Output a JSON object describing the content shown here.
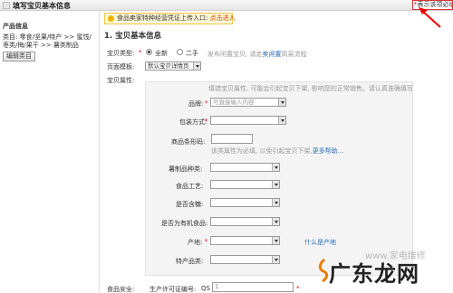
{
  "titlebar": {
    "title": "填写宝贝基本信息",
    "required_note_star": "*",
    "required_note": "表示该项必填"
  },
  "sidebar": {
    "heading": "产品信息",
    "category": "类目: 零食/坚果/特产 >> 蜜饯/枣类/梅/果干 >> 薯类制品",
    "edit_button": "编辑类目"
  },
  "notice": {
    "text": "食品卖家特种经营凭证上传入口: ",
    "link": "点击进入"
  },
  "section": {
    "title": "1. 宝贝基本信息"
  },
  "item_type": {
    "label": "宝贝类型:",
    "required": "*",
    "options": [
      "全新",
      "二手"
    ],
    "selected": "全新",
    "hint_prefix": "发布闲置宝贝, 请走",
    "hint_link": "卖闲置",
    "hint_suffix": "简易流程"
  },
  "template": {
    "label": "页面模板:",
    "value": "默认宝贝详情页"
  },
  "attributes": {
    "label": "宝贝属性:",
    "intro": "填错宝贝属性, 可能会引起宝贝下架, 影响您的正常销售。请认真准确填写",
    "brand": {
      "label": "品牌:",
      "required": "*",
      "placeholder": "可直接输入内容"
    },
    "packaging": {
      "label": "包装方式:",
      "required": "*",
      "value": ""
    },
    "barcode": {
      "label": "商品条形码:",
      "value": "",
      "hint": "该类属性为必填, 以免引起宝贝下架,",
      "help_link": "更多帮助..."
    },
    "potato_type": {
      "label": "薯制品种类:",
      "value": ""
    },
    "craft": {
      "label": "食品工艺:",
      "value": ""
    },
    "sugar": {
      "label": "是否含糖:",
      "value": ""
    },
    "organic": {
      "label": "是否为有机食品:",
      "value": ""
    },
    "origin": {
      "label": "产地:",
      "required": "*",
      "value": "",
      "help_link": "什么是产地"
    },
    "specialty": {
      "label": "特产品类:",
      "value": ""
    }
  },
  "food_safety": {
    "label": "食品安全:",
    "license_label": "生产许可证编号:",
    "license_prefix": "QS",
    "license_value": "1",
    "required": "*"
  },
  "watermark": {
    "brand_text": "广东龙网",
    "small_text": "www.家电维修"
  }
}
